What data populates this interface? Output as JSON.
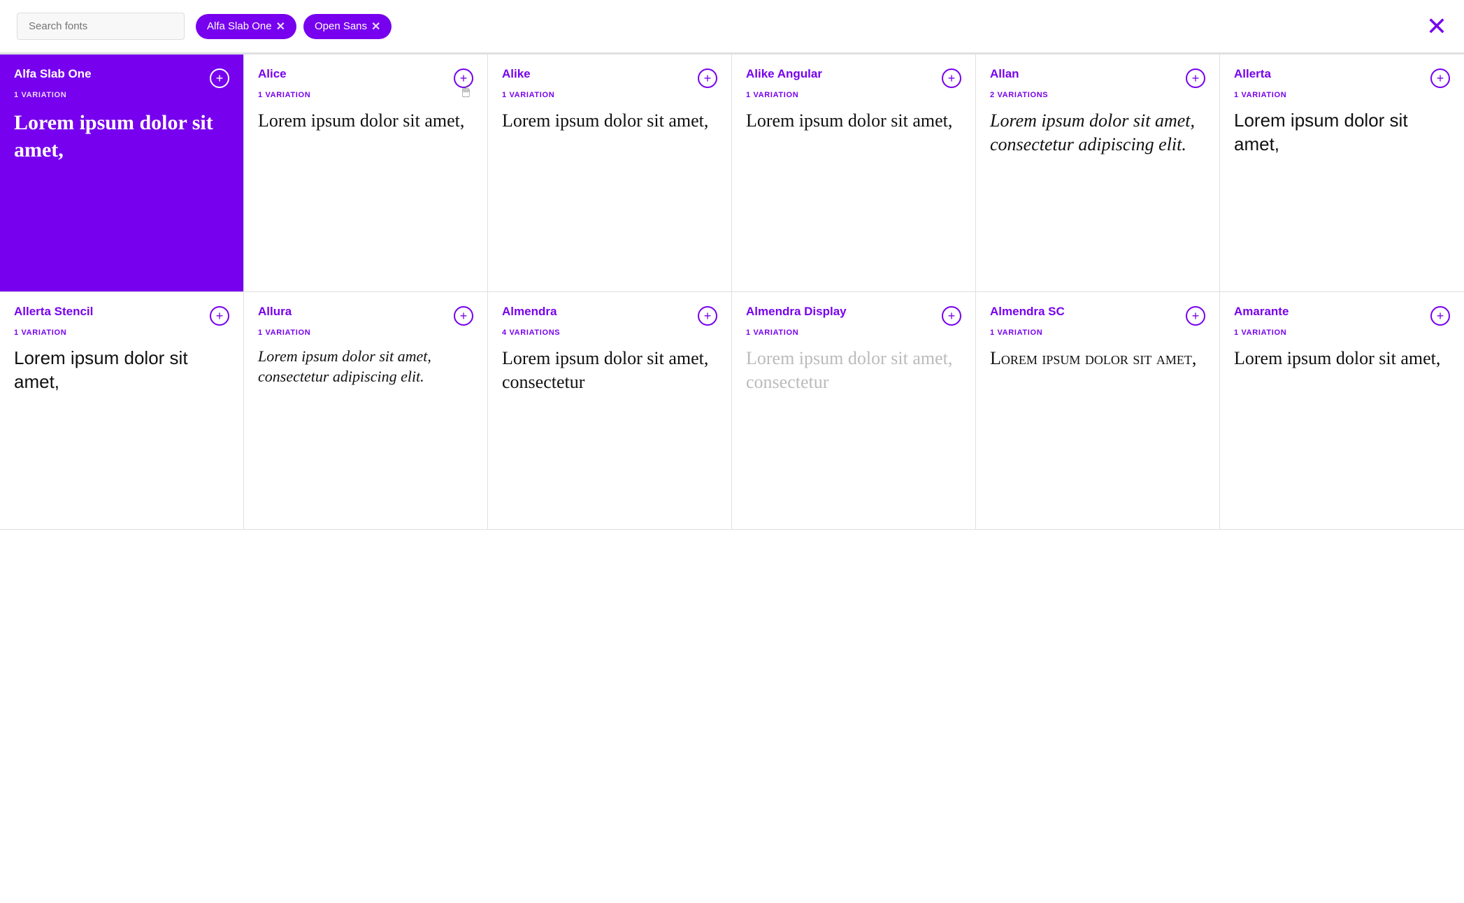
{
  "header": {
    "search_placeholder": "Search fonts",
    "chips": [
      {
        "label": "Alfa Slab One",
        "id": "chip-alfa"
      },
      {
        "label": "Open Sans",
        "id": "chip-opensans"
      }
    ],
    "close_label": "✕"
  },
  "fonts_row1": [
    {
      "name": "Alfa Slab One",
      "variations": "1 VARIATION",
      "preview": "Lorem ipsum dolor sit amet,",
      "active": true,
      "style": "alfa"
    },
    {
      "name": "Alice",
      "variations": "1 VARIATION",
      "preview": "Lorem ipsum dolor sit amet,",
      "active": false,
      "style": "alice",
      "cursor": true
    },
    {
      "name": "Alike",
      "variations": "1 VARIATION",
      "preview": "Lorem ipsum dolor sit amet,",
      "active": false,
      "style": "alike"
    },
    {
      "name": "Alike Angular",
      "variations": "1 VARIATION",
      "preview": "Lorem ipsum dolor sit amet,",
      "active": false,
      "style": "alike-angular"
    },
    {
      "name": "Allan",
      "variations": "2 VARIATIONS",
      "preview": "Lorem ipsum dolor sit amet, consectetur adipiscing elit.",
      "active": false,
      "style": "allan"
    },
    {
      "name": "Allerta",
      "variations": "1 VARIATION",
      "preview": "Lorem ipsum dolor sit amet,",
      "active": false,
      "style": "allerta"
    }
  ],
  "fonts_row2": [
    {
      "name": "Allerta Stencil",
      "variations": "1 VARIATION",
      "preview": "Lorem ipsum dolor sit amet,",
      "active": false,
      "style": "allerta-stencil"
    },
    {
      "name": "Allura",
      "variations": "1 VARIATION",
      "preview": "Lorem ipsum dolor sit amet, consectetur adipiscing elit.",
      "active": false,
      "style": "allura"
    },
    {
      "name": "Almendra",
      "variations": "4 VARIATIONS",
      "preview": "Lorem ipsum dolor sit amet, consectetur",
      "active": false,
      "style": "almendra"
    },
    {
      "name": "Almendra Display",
      "variations": "1 VARIATION",
      "preview": "Lorem ipsum dolor sit amet, consectetur",
      "active": false,
      "style": "almendra-display"
    },
    {
      "name": "Almendra SC",
      "variations": "1 VARIATION",
      "preview": "Lorem ipsum dolor sit amet,",
      "active": false,
      "style": "almendra-sc"
    },
    {
      "name": "Amarante",
      "variations": "1 VARIATION",
      "preview": "Lorem ipsum dolor sit amet,",
      "active": false,
      "style": "amarante"
    }
  ],
  "add_button_label": "+",
  "lorem_text": "Lorem ipsum dolor sit amet,"
}
